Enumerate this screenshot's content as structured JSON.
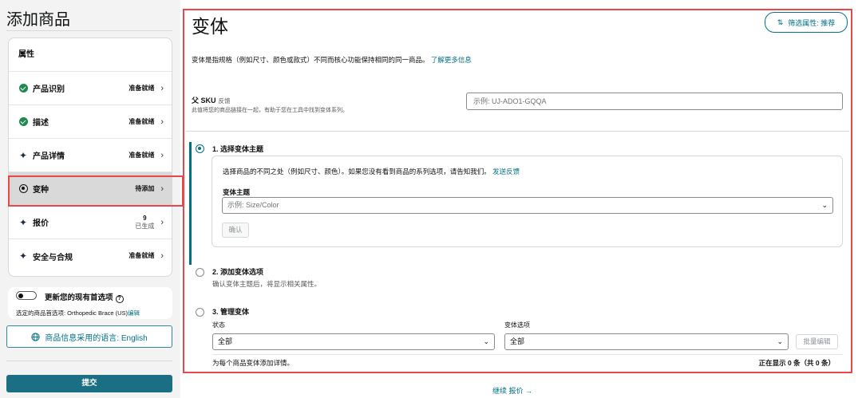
{
  "sidebar": {
    "title": "添加商品",
    "nav_header": "属性",
    "items": [
      {
        "label": "产品识别",
        "status": "准备就绪",
        "status_sub": ""
      },
      {
        "label": "描述",
        "status": "准备就绪",
        "status_sub": ""
      },
      {
        "label": "产品详情",
        "status": "准备就绪",
        "status_sub": ""
      },
      {
        "label": "变种",
        "status": "待添加",
        "status_sub": ""
      },
      {
        "label": "报价",
        "status": "9",
        "status_sub": "已生成"
      },
      {
        "label": "安全与合规",
        "status": "准备就绪",
        "status_sub": ""
      }
    ],
    "preferences": {
      "label": "更新您的现有首选项",
      "selected_prefix": "选定的商品首选项: Orthopedic Brace (US)",
      "edit_link": "编辑"
    },
    "language_button": "商品信息采用的语言: English",
    "submit_button": "提交"
  },
  "main": {
    "title": "变体",
    "filter_button": "筛选属性: 推荐",
    "description": "变体是指规格（例如尺寸、颜色或款式）不同而核心功能保持相同的同一商品。",
    "learn_more": "了解更多信息",
    "parent_sku": {
      "label": "父 SKU",
      "feedback": "反馈",
      "help": "此值将您的商品链接在一起，有助于您在工具中找到变体系列。",
      "placeholder": "示例:  UJ-ADO1-GQQA"
    },
    "step1": {
      "title": "1. 选择变体主题",
      "description": "选择商品的不同之处（例如尺寸、颜色）。如果您没有看到商品的系列选项，请告知我们。",
      "feedback_link": "发送反馈",
      "theme_label": "变体主题",
      "theme_placeholder": "示例:  Size/Color",
      "confirm_button": "确认"
    },
    "step2": {
      "title": "2. 添加变体选项",
      "subtitle": "确认变体主题后，将显示相关属性。"
    },
    "step3": {
      "title": "3. 管理变体",
      "status_label": "状态",
      "status_value": "全部",
      "options_label": "变体选项",
      "options_value": "全部",
      "bulk_edit_button": "批量编辑",
      "footer_left": "为每个商品变体添加详情。",
      "footer_right": "正在显示 0 条（共 0 条）"
    },
    "continue_link": "继续 报价  →"
  },
  "colors": {
    "accent": "#007185",
    "submit": "#1b6f85",
    "highlight": "#e8484a",
    "ready_check": "#1e8a4c"
  },
  "icons": [
    "check-circle-icon",
    "sparkle-icon",
    "radio-icon",
    "chevron-right-icon",
    "chevron-down-icon",
    "globe-icon",
    "help-icon",
    "filter-icon"
  ]
}
